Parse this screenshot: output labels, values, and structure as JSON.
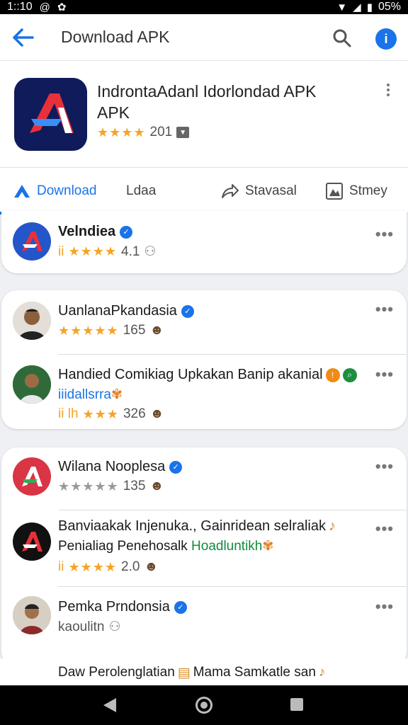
{
  "status_bar": {
    "time": "1::10",
    "battery": "05%"
  },
  "app_bar": {
    "title": "Download APK"
  },
  "app": {
    "title": "IndrontaAdanl Idorlondad APK APK",
    "rating_count": "201",
    "icon_colors": {
      "bg": "#0f1b5a",
      "primary": "#e8303a",
      "secondary": "#3a8ef6"
    }
  },
  "tabs": [
    {
      "label": "Download"
    },
    {
      "label": "Ldaa"
    },
    {
      "label": "Stavasal"
    },
    {
      "label": "Stmey"
    }
  ],
  "cards": [
    {
      "rows": [
        {
          "name": "Velndiea",
          "prefix": "ii",
          "rating": "4.1"
        }
      ]
    },
    {
      "rows": [
        {
          "name": "UanlanaPkandasia",
          "rating": "165"
        },
        {
          "name": "Handied Comikiag Upkakan Banip akanial",
          "sub": "iiidallsrra",
          "prefix": "ii lh",
          "rating": "326"
        }
      ]
    },
    {
      "rows": [
        {
          "name": "Wilana Nooplesa",
          "rating": "135"
        },
        {
          "name": "Banviaakak Injenuka., Gainridean selraliak",
          "sub_label": "Penialiag Penehosalk",
          "sub": "Hoadluntikh",
          "prefix": "ii",
          "rating": "2.0"
        },
        {
          "name": "Pemka Prndonsia",
          "sub": "kaoulitn"
        }
      ]
    }
  ],
  "bottom_text": "Daw Perolenglatian",
  "bottom_text_2": "Mama Samkatle san"
}
